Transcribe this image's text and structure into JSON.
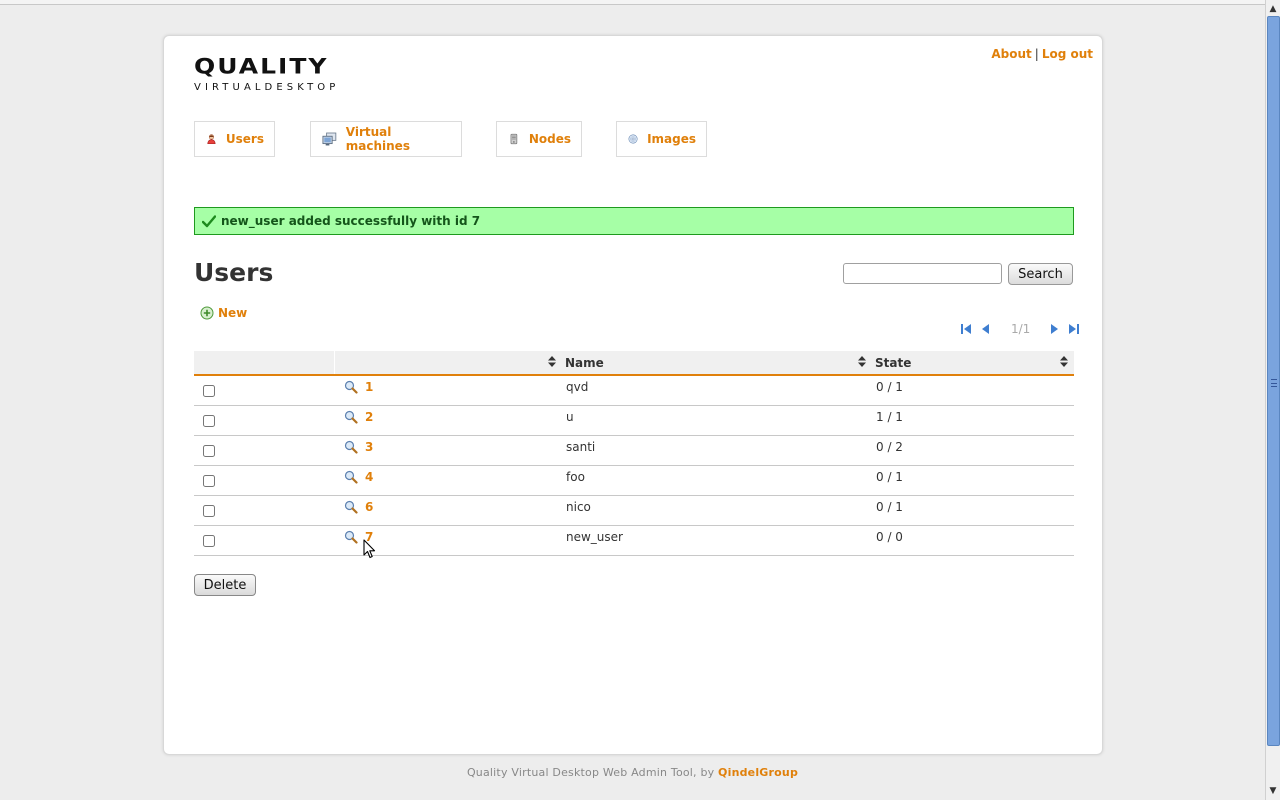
{
  "header": {
    "logo_title": "QUALITY",
    "logo_subtitle": "VIRTUALDESKTOP",
    "about_link": "About",
    "separator": "|",
    "logout_link": "Log out"
  },
  "tabs": [
    {
      "label": "Users",
      "icon": "user-icon"
    },
    {
      "label": "Virtual machines",
      "icon": "computer-icon"
    },
    {
      "label": "Nodes",
      "icon": "server-icon"
    },
    {
      "label": "Images",
      "icon": "disc-icon"
    }
  ],
  "flash": {
    "message": "new_user added successfully with id 7",
    "color": "#a6ffa6"
  },
  "page": {
    "title": "Users",
    "new_label": "New",
    "search_placeholder": "",
    "search_value": "",
    "search_button": "Search",
    "delete_button": "Delete"
  },
  "pagination": {
    "label": "1/1"
  },
  "table": {
    "columns": [
      "",
      "",
      "Name",
      "State"
    ],
    "rows": [
      {
        "id": "1",
        "name": "qvd",
        "state": "0 / 1"
      },
      {
        "id": "2",
        "name": "u",
        "state": "1 / 1"
      },
      {
        "id": "3",
        "name": "santi",
        "state": "0 / 2"
      },
      {
        "id": "4",
        "name": "foo",
        "state": "0 / 1"
      },
      {
        "id": "6",
        "name": "nico",
        "state": "0 / 1"
      },
      {
        "id": "7",
        "name": "new_user",
        "state": "0 / 0"
      }
    ]
  },
  "footer": {
    "text": "Quality Virtual Desktop Web Admin Tool, by",
    "link": "QindelGroup"
  },
  "colors": {
    "accent": "#e0800b",
    "flash_border": "#1e9a1e"
  }
}
